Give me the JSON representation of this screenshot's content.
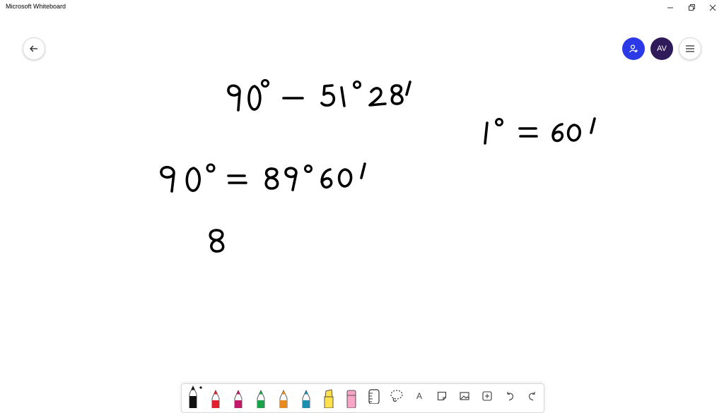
{
  "window": {
    "title": "Microsoft Whiteboard",
    "controls": [
      "minimize",
      "restore",
      "close"
    ]
  },
  "header": {
    "back_icon": "arrow-left-icon",
    "invite_icon": "person-add-icon",
    "avatar_initials": "AV",
    "menu_icon": "hamburger-icon",
    "colors": {
      "invite": "#2b3ae6",
      "avatar": "#2f1b5a"
    }
  },
  "canvas": {
    "ink_lines": [
      "90° − 51°28′",
      "1° = 60′",
      "90° = 89°60′",
      "8"
    ],
    "ink_color": "#000000"
  },
  "toolbar": {
    "tools": [
      {
        "name": "pen-black",
        "color": "#111111",
        "selected": true
      },
      {
        "name": "pen-red",
        "color": "#e0202c"
      },
      {
        "name": "pen-magenta",
        "color": "#c2186a"
      },
      {
        "name": "pen-green",
        "color": "#1aa24a"
      },
      {
        "name": "pen-rainbow",
        "color": "#e88a1c"
      },
      {
        "name": "pen-galaxy",
        "color": "#1b8fb0"
      },
      {
        "name": "highlighter",
        "color": "#ffe14d"
      },
      {
        "name": "eraser",
        "color": "#f7a6c8"
      }
    ],
    "icons": [
      "ruler-icon",
      "lasso-icon",
      "text-icon",
      "sticky-note-icon",
      "image-icon",
      "insert-icon",
      "undo-icon",
      "redo-icon"
    ],
    "text_label": "A"
  }
}
